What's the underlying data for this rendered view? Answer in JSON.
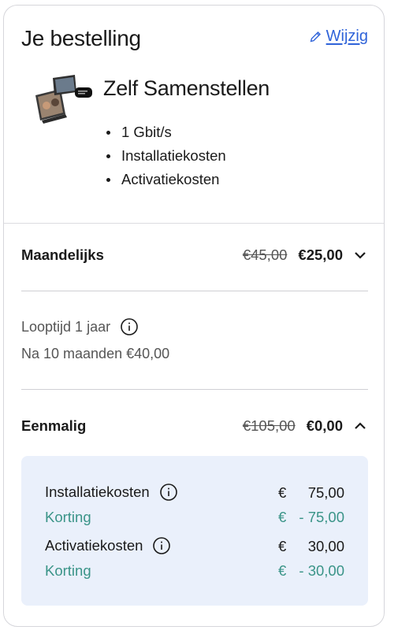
{
  "header": {
    "title": "Je bestelling",
    "edit_label": "Wijzig"
  },
  "product": {
    "name": "Zelf Samenstellen",
    "features": [
      "1 Gbit/s",
      "Installatiekosten",
      "Activatiekosten"
    ]
  },
  "monthly": {
    "label": "Maandelijks",
    "old_price": "€45,00",
    "new_price": "€25,00",
    "expanded": false
  },
  "contract": {
    "duration": "Looptijd 1 jaar",
    "after": "Na 10 maanden €40,00"
  },
  "one_time": {
    "label": "Eenmalig",
    "old_price": "€105,00",
    "new_price": "€0,00",
    "expanded": true,
    "items": [
      {
        "label": "Installatiekosten",
        "currency": "€",
        "amount": "75,00",
        "info": true
      },
      {
        "label": "Korting",
        "currency": "€",
        "amount": "- 75,00",
        "discount": true
      },
      {
        "label": "Activatiekosten",
        "currency": "€",
        "amount": "30,00",
        "info": true
      },
      {
        "label": "Korting",
        "currency": "€",
        "amount": "- 30,00",
        "discount": true
      }
    ]
  },
  "colors": {
    "link": "#2f63d9",
    "discount": "#3a9488",
    "panel_bg": "#eaf0fb"
  },
  "icons": {
    "edit": "pencil-icon",
    "info": "info-icon",
    "chevron_down": "chevron-down-icon",
    "chevron_up": "chevron-up-icon"
  }
}
